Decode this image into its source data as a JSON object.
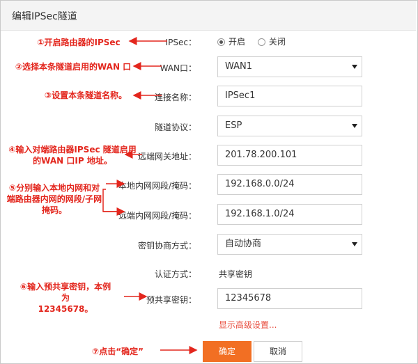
{
  "header": {
    "title": "编辑IPSec隧道"
  },
  "form": {
    "ipsec": {
      "label": "IPSec：",
      "options": [
        "开启",
        "关闭"
      ],
      "selected": "开启"
    },
    "wan": {
      "label": "WAN口：",
      "value": "WAN1"
    },
    "name": {
      "label": "连接名称：",
      "value": "IPSec1"
    },
    "protocol": {
      "label": "隧道协议：",
      "value": "ESP"
    },
    "remote_gateway": {
      "label": "远端网关地址：",
      "value": "201.78.200.101"
    },
    "local_subnet": {
      "label": "本地内网网段/掩码：",
      "value": "192.168.0.0/24"
    },
    "remote_subnet": {
      "label": "远端内网网段/掩码：",
      "value": "192.168.1.0/24"
    },
    "negotiation": {
      "label": "密钥协商方式：",
      "value": "自动协商"
    },
    "auth": {
      "label": "认证方式：",
      "value": "共享密钥"
    },
    "psk": {
      "label": "预共享密钥：",
      "value": "12345678"
    },
    "advanced_link": "显示高级设置...",
    "ok_label": "确定",
    "cancel_label": "取消"
  },
  "annotations": {
    "a1": "①开启路由器的IPSec",
    "a2": "②选择本条隧道启用的WAN 口",
    "a3": "③设置本条隧道名称。",
    "a4_line1": "④输入对端路由器IPSec 隧道启用",
    "a4_line2": "的WAN 口IP 地址。",
    "a5_line1": "⑤分别输入本地内网和对",
    "a5_line2": "端路由器内网的网段/子网",
    "a5_line3": "掩码。",
    "a6_line1": "⑥输入预共享密钥，本例",
    "a6_line2": "为",
    "a6_line3": "12345678。",
    "a7": "⑦点击“确定”"
  },
  "colors": {
    "accent": "#f26f23",
    "annotation": "#e3261d",
    "link": "#e84c3d"
  }
}
